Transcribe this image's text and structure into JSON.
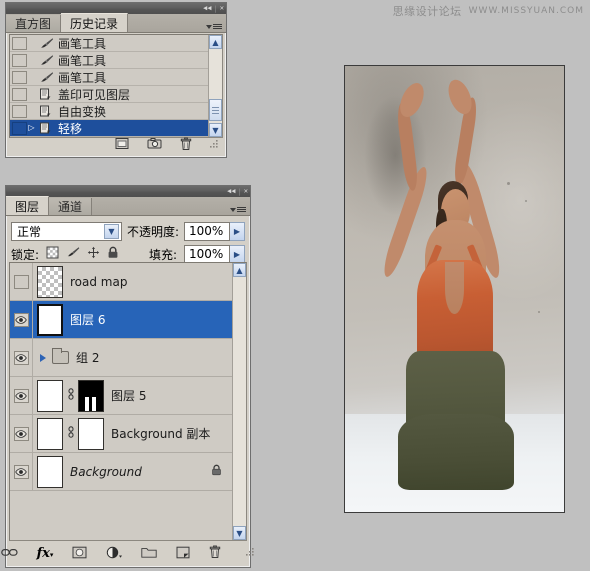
{
  "watermark": {
    "cn": "思缘设计论坛",
    "en": "WWW.MISSYUAN.COM"
  },
  "history_panel": {
    "titlebar": {
      "collapse_label": "◀◀",
      "separator": "|",
      "close_label": "✕"
    },
    "tabs": [
      {
        "label": "直方图",
        "active": false
      },
      {
        "label": "历史记录",
        "active": true
      }
    ],
    "menu_name": "panel-menu",
    "rows": [
      {
        "label": "画笔工具",
        "icon": "brush-icon",
        "selected": false
      },
      {
        "label": "画笔工具",
        "icon": "brush-icon",
        "selected": false
      },
      {
        "label": "画笔工具",
        "icon": "brush-icon",
        "selected": false
      },
      {
        "label": "盖印可见图层",
        "icon": "document-icon",
        "selected": false
      },
      {
        "label": "自由变换",
        "icon": "document-icon",
        "selected": false
      },
      {
        "label": "轻移",
        "icon": "document-icon",
        "selected": true
      }
    ],
    "scrollbar": {
      "up": "▲",
      "down": "▼"
    },
    "footer_buttons": [
      {
        "name": "new-document-from-state-button",
        "icon": "new-document-icon"
      },
      {
        "name": "new-snapshot-button",
        "icon": "camera-icon"
      },
      {
        "name": "delete-state-button",
        "icon": "trash-icon"
      }
    ],
    "selection_color": "#1e4f9c"
  },
  "layers_panel": {
    "titlebar": {
      "collapse_label": "◀◀",
      "separator": "|",
      "close_label": "✕"
    },
    "tabs": [
      {
        "label": "图层",
        "active": true
      },
      {
        "label": "通道",
        "active": false
      }
    ],
    "blend_mode": "正常",
    "opacity_label": "不透明度:",
    "opacity_value": "100%",
    "lock_label": "锁定:",
    "lock_icons": [
      {
        "name": "lock-transparency-icon"
      },
      {
        "name": "lock-image-pixels-icon"
      },
      {
        "name": "lock-position-icon"
      },
      {
        "name": "lock-all-icon"
      }
    ],
    "fill_label": "填充:",
    "fill_value": "100%",
    "layers": [
      {
        "name": "road map",
        "visible": false,
        "selected": false,
        "thumb": "checker",
        "italic": false,
        "locked": false,
        "has_mask": false,
        "is_group": false
      },
      {
        "name": "图层 6",
        "visible": true,
        "selected": true,
        "thumb": "photo",
        "italic": false,
        "locked": false,
        "has_mask": false,
        "is_group": false
      },
      {
        "name": "组 2",
        "visible": true,
        "selected": false,
        "thumb": "folder",
        "italic": false,
        "locked": false,
        "has_mask": false,
        "is_group": true
      },
      {
        "name": "图层 5",
        "visible": true,
        "selected": false,
        "thumb": "photo",
        "italic": false,
        "locked": false,
        "has_mask": true,
        "mask_type": "black",
        "is_group": false
      },
      {
        "name": "Background 副本",
        "visible": true,
        "selected": false,
        "thumb": "photo",
        "italic": false,
        "locked": false,
        "has_mask": true,
        "mask_type": "white",
        "is_group": false
      },
      {
        "name": "Background",
        "visible": true,
        "selected": false,
        "thumb": "photo",
        "italic": true,
        "locked": true,
        "has_mask": false,
        "is_group": false
      }
    ],
    "scrollbar": {
      "up": "▲",
      "down": "▼"
    },
    "footer_buttons": [
      {
        "name": "link-layers-button",
        "icon": "link-icon",
        "label": "⛓"
      },
      {
        "name": "layer-style-button",
        "icon": "fx-icon",
        "label": "fx"
      },
      {
        "name": "add-layer-mask-button",
        "icon": "mask-icon"
      },
      {
        "name": "adjustment-layer-button",
        "icon": "half-circle-icon"
      },
      {
        "name": "new-group-button",
        "icon": "folder-icon"
      },
      {
        "name": "new-layer-button",
        "icon": "new-layer-icon"
      },
      {
        "name": "delete-layer-button",
        "icon": "trash-icon"
      }
    ],
    "selection_color": "#2764b8"
  },
  "canvas": {
    "name": "document-canvas",
    "description": "dancer photo"
  }
}
